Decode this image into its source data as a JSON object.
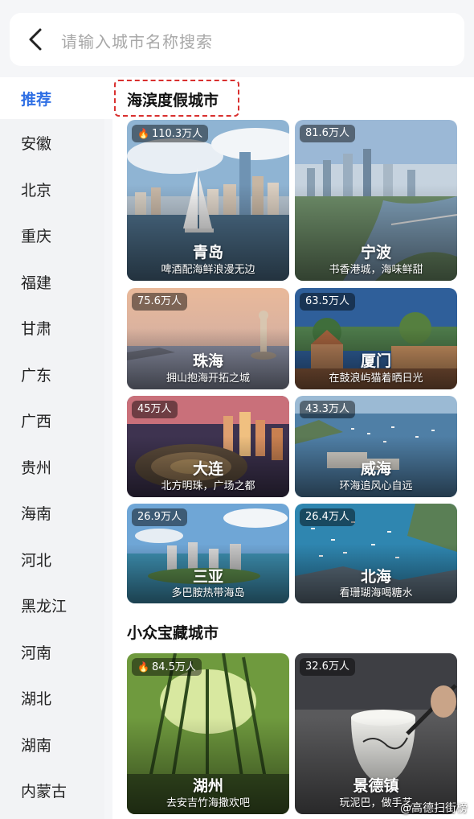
{
  "search": {
    "placeholder": "请输入城市名称搜索"
  },
  "sidebar": {
    "items": [
      "推荐",
      "安徽",
      "北京",
      "重庆",
      "福建",
      "甘肃",
      "广东",
      "广西",
      "贵州",
      "海南",
      "河北",
      "黑龙江",
      "河南",
      "湖北",
      "湖南",
      "内蒙古"
    ],
    "active_index": 0,
    "active_color": "#2f6fe4"
  },
  "sections": [
    {
      "title": "海滨度假城市",
      "cards": [
        {
          "count": "110.3万人",
          "hot": true,
          "name": "青岛",
          "tagline": "啤酒配海鲜浪漫无边"
        },
        {
          "count": "81.6万人",
          "hot": false,
          "name": "宁波",
          "tagline": "书香港城，海味鲜甜"
        },
        {
          "count": "75.6万人",
          "hot": false,
          "name": "珠海",
          "tagline": "拥山抱海开拓之城"
        },
        {
          "count": "63.5万人",
          "hot": false,
          "name": "厦门",
          "tagline": "在鼓浪屿猫着晒日光"
        },
        {
          "count": "45万人",
          "hot": false,
          "name": "大连",
          "tagline": "北方明珠，广场之都"
        },
        {
          "count": "43.3万人",
          "hot": false,
          "name": "威海",
          "tagline": "环海追风心自远"
        },
        {
          "count": "26.9万人",
          "hot": false,
          "name": "三亚",
          "tagline": "多巴胺热带海岛"
        },
        {
          "count": "26.4万人",
          "hot": false,
          "name": "北海",
          "tagline": "看珊瑚海喝糖水"
        }
      ]
    },
    {
      "title": "小众宝藏城市",
      "cards": [
        {
          "count": "84.5万人",
          "hot": true,
          "name": "湖州",
          "tagline": "去安吉竹海撒欢吧"
        },
        {
          "count": "32.6万人",
          "hot": false,
          "name": "景德镇",
          "tagline": "玩泥巴，做手艺"
        }
      ]
    }
  ],
  "watermark": "@高德扫街榜",
  "colors": {
    "accent": "#2f6fe4",
    "highlight_border": "#d9302f",
    "hot_icon": "#ff6a3d"
  }
}
